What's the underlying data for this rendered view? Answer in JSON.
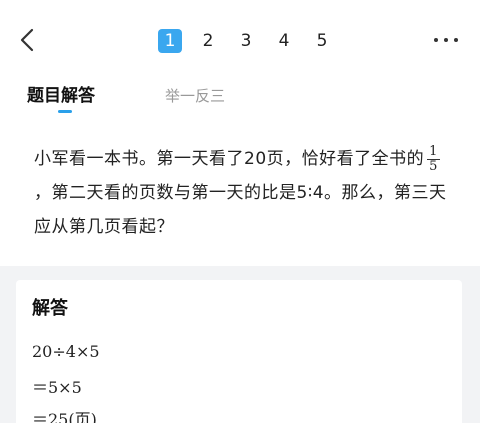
{
  "header": {
    "back_icon": "chevron-left-icon",
    "pages": [
      "1",
      "2",
      "3",
      "4",
      "5"
    ],
    "active_page": "1",
    "more_icon": "more-dots-icon",
    "accent_color": "#3aa7ef"
  },
  "tabs": {
    "answer": "题目解答",
    "similar": "举一反三"
  },
  "question": {
    "part1": "小军看一本书。第一天看了20页，恰好看了全书的",
    "fraction_num": "1",
    "fraction_den": "5",
    "part2": "，第二天看的页数与第一天的比是5∶4。那么，第三天应从第几页看起？"
  },
  "answer": {
    "title": "解答",
    "lines": [
      "20÷4×5",
      "＝5×5",
      "＝25(页)"
    ]
  }
}
